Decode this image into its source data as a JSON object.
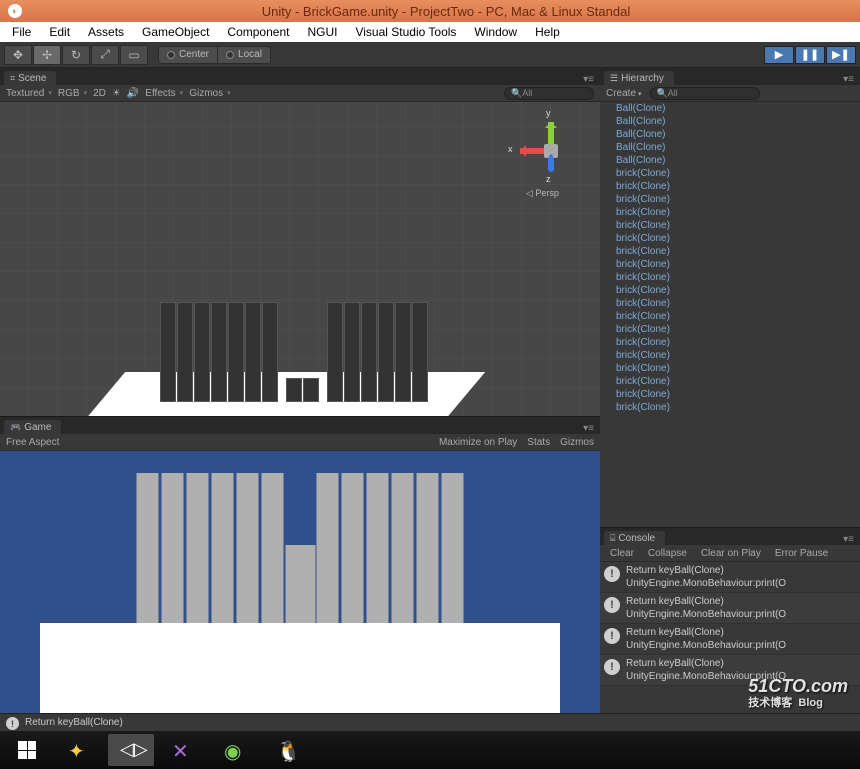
{
  "titlebar": {
    "title": "Unity - BrickGame.unity - ProjectTwo - PC, Mac & Linux Standal"
  },
  "menubar": [
    "File",
    "Edit",
    "Assets",
    "GameObject",
    "Component",
    "NGUI",
    "Visual Studio Tools",
    "Window",
    "Help"
  ],
  "toolbar": {
    "pivot_label": "Center",
    "space_label": "Local"
  },
  "scene": {
    "tab": "Scene",
    "shading": "Textured",
    "render": "RGB",
    "mode2d": "2D",
    "effects": "Effects",
    "gizmos": "Gizmos",
    "search_placeholder": "All",
    "persp": "Persp",
    "axes": {
      "x": "x",
      "y": "y",
      "z": "z"
    }
  },
  "game": {
    "tab": "Game",
    "aspect": "Free Aspect",
    "maximize": "Maximize on Play",
    "stats": "Stats",
    "gizmos": "Gizmos"
  },
  "hierarchy": {
    "tab": "Hierarchy",
    "create": "Create",
    "search_placeholder": "All",
    "items": [
      "Ball(Clone)",
      "Ball(Clone)",
      "Ball(Clone)",
      "Ball(Clone)",
      "Ball(Clone)",
      "brick(Clone)",
      "brick(Clone)",
      "brick(Clone)",
      "brick(Clone)",
      "brick(Clone)",
      "brick(Clone)",
      "brick(Clone)",
      "brick(Clone)",
      "brick(Clone)",
      "brick(Clone)",
      "brick(Clone)",
      "brick(Clone)",
      "brick(Clone)",
      "brick(Clone)",
      "brick(Clone)",
      "brick(Clone)",
      "brick(Clone)",
      "brick(Clone)",
      "brick(Clone)"
    ]
  },
  "console": {
    "tab": "Console",
    "buttons": {
      "clear": "Clear",
      "collapse": "Collapse",
      "clear_on_play": "Clear on Play",
      "error_pause": "Error Pause"
    },
    "entries": [
      {
        "msg": "Return keyBall(Clone)",
        "trace": "UnityEngine.MonoBehaviour:print(O"
      },
      {
        "msg": "Return keyBall(Clone)",
        "trace": "UnityEngine.MonoBehaviour:print(O"
      },
      {
        "msg": "Return keyBall(Clone)",
        "trace": "UnityEngine.MonoBehaviour:print(O"
      },
      {
        "msg": "Return keyBall(Clone)",
        "trace": "UnityEngine.MonoBehaviour:print(O"
      }
    ]
  },
  "statusbar": {
    "msg": "Return keyBall(Clone)"
  },
  "watermark": {
    "line1": "51CTO.com",
    "line2": "技术博客",
    "badge": "Blog"
  }
}
